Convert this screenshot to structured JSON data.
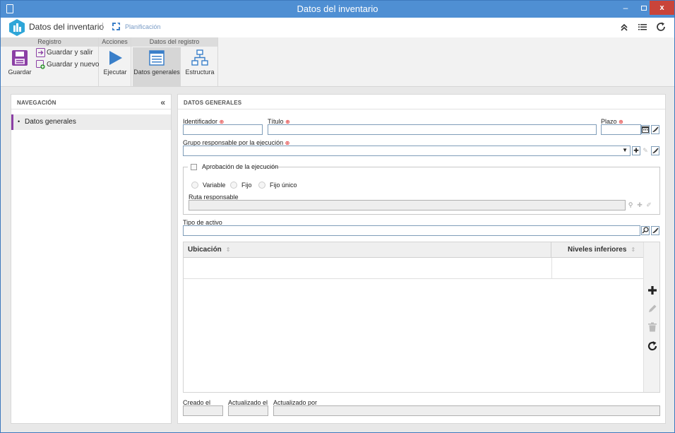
{
  "window": {
    "title": "Datos del inventario",
    "close_label": "x",
    "min_label": "–"
  },
  "header": {
    "app_title": "Datos del inventario",
    "separator": "|",
    "planning_label": "Planificación"
  },
  "ribbon": {
    "groups": {
      "registro": "Registro",
      "acciones": "Acciones",
      "datos_registro": "Datos del registro"
    },
    "save": "Guardar",
    "save_exit": "Guardar y salir",
    "save_new": "Guardar y nuevo",
    "execute": "Ejecutar",
    "general_data": "Datos generales",
    "structure": "Estructura"
  },
  "nav": {
    "title": "NAVEGACIÓN",
    "collapse": "«",
    "items": [
      {
        "label": "Datos generales",
        "bullet": "•"
      }
    ]
  },
  "form": {
    "title": "DATOS GENERALES",
    "required_mark": "⊕",
    "identifier": {
      "label": "Identificador",
      "value": ""
    },
    "title_field": {
      "label": "Título",
      "value": ""
    },
    "deadline": {
      "label": "Plazo",
      "value": ""
    },
    "exec_group": {
      "label": "Grupo responsable por la ejecución",
      "value": ""
    },
    "approval": {
      "label": "Aprobación de la ejecución",
      "options": [
        "Variable",
        "Fijo",
        "Fijo único"
      ],
      "route_label": "Ruta responsable",
      "route_value": ""
    },
    "asset_type": {
      "label": "Tipo de activo",
      "value": ""
    },
    "table": {
      "columns": [
        "Ubicación",
        "Niveles inferiores"
      ],
      "sort_glyph": "⇕"
    },
    "created": {
      "label": "Creado el",
      "value": ""
    },
    "updated": {
      "label": "Actualizado el",
      "value": ""
    },
    "updated_by": {
      "label": "Actualizado por",
      "value": ""
    }
  },
  "colors": {
    "titlebar": "#4f8fd3",
    "accent_purple": "#8b3fa5",
    "close_red": "#c9443a",
    "required_red": "#dd2222"
  }
}
